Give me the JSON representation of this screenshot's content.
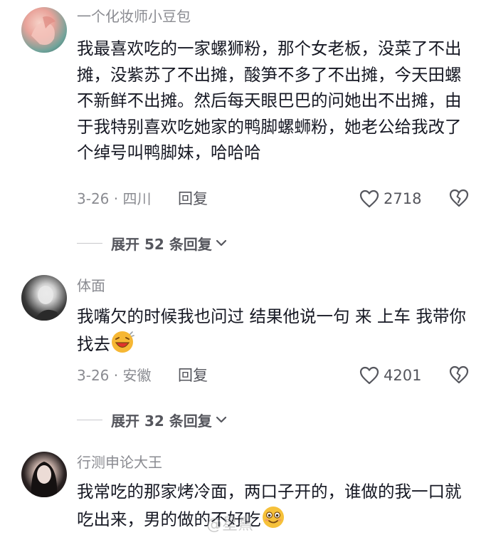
{
  "comments": [
    {
      "username": "一个化妆师小豆包",
      "text": "我最喜欢吃的一家螺狮粉，那个女老板，没菜了不出摊，没紫苏了不出摊，酸笋不多了不出摊，今天田螺不新鲜不出摊。然后每天眼巴巴的问她出不出摊，由于我特别喜欢吃她家的鸭脚螺蛳粉，她老公给我改了个绰号叫鸭脚妹，哈哈哈",
      "meta": "3-26 · 四川",
      "reply_label": "回复",
      "likes": "2718",
      "expand_label": "展开 52 条回复"
    },
    {
      "username": "体面",
      "text": "我嘴欠的时候我也问过 结果他说一句 来 上车 我带你找去",
      "meta": "3-26 · 安徽",
      "reply_label": "回复",
      "likes": "4201",
      "expand_label": "展开 32 条回复"
    },
    {
      "username": "行测申论大王",
      "text": "我常吃的那家烤冷面，两口子开的，谁做的我一口就吃出来，男的做的不好吃"
    }
  ],
  "watermark": "@星熹"
}
